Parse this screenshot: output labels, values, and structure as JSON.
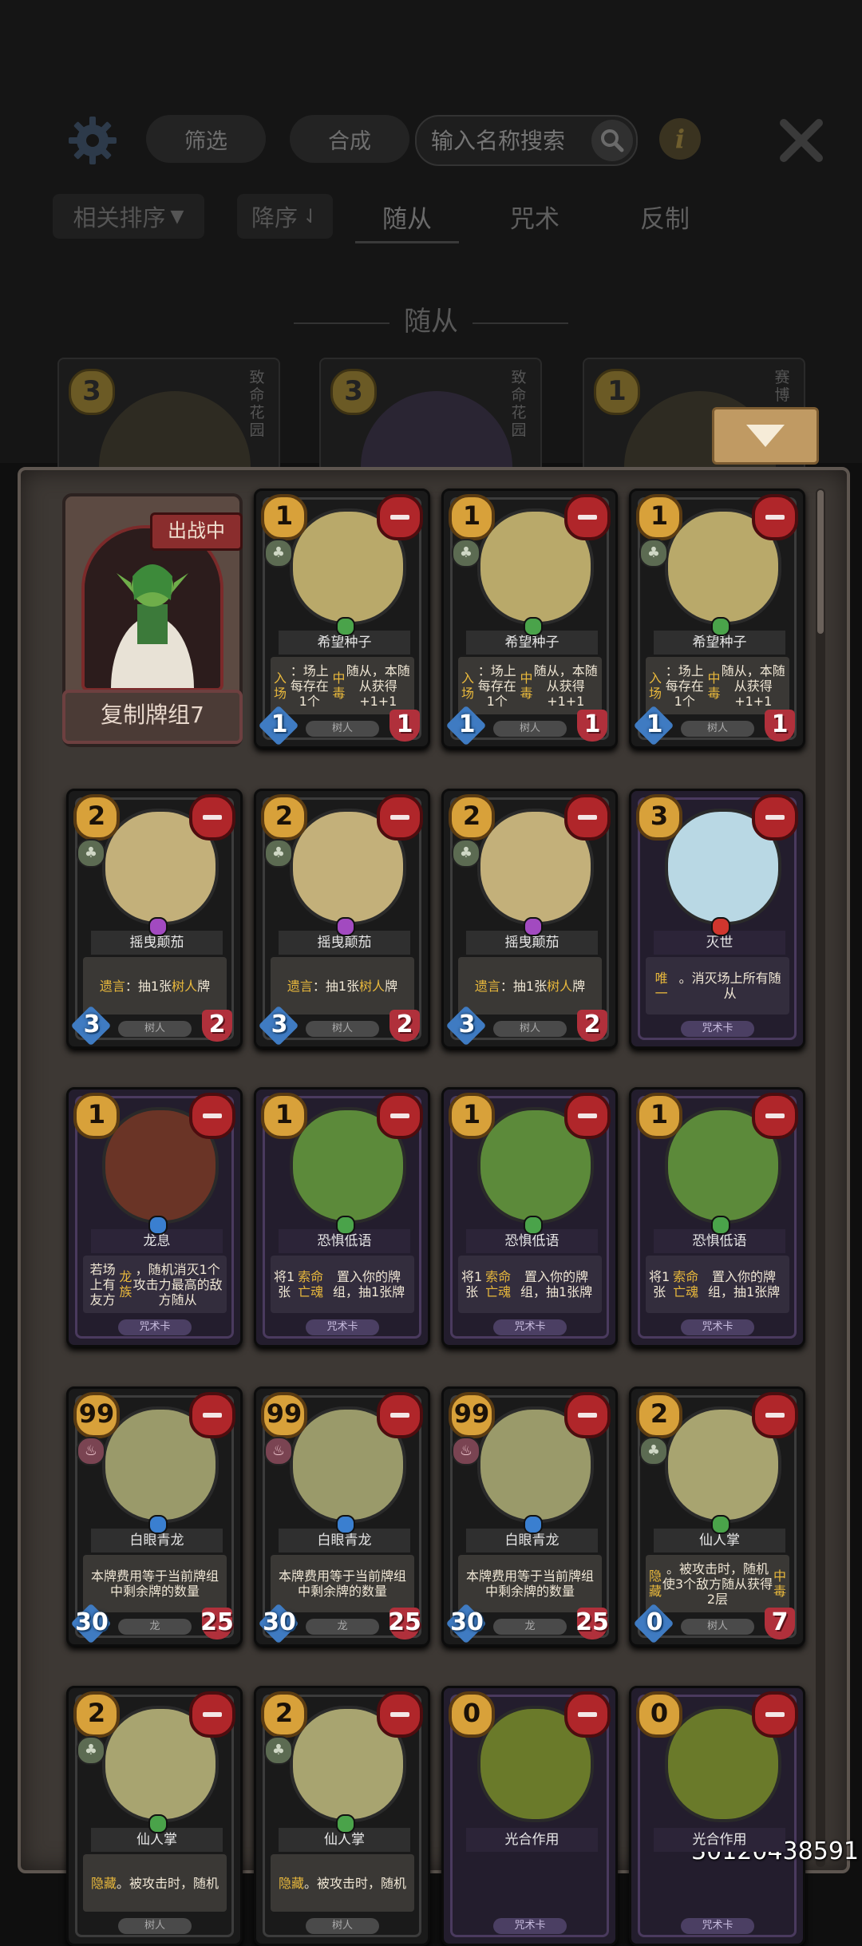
{
  "header": {
    "filter_label": "筛选",
    "synthesize_label": "合成",
    "search_placeholder": "输入名称搜索"
  },
  "tabs": {
    "sort_label": "相关排序",
    "order_label": "降序",
    "minion": "随从",
    "spell": "咒术",
    "counter": "反制"
  },
  "section_title": "随从",
  "top_cards": [
    {
      "cost": "3",
      "side": "致命花园"
    },
    {
      "cost": "3",
      "side": "致命花园"
    },
    {
      "cost": "1",
      "side": "赛博"
    }
  ],
  "deck": {
    "badge": "出战中",
    "name": "复制牌组7"
  },
  "cards": [
    {
      "cost": "1",
      "name": "希望种子",
      "type": "树人",
      "atk": "1",
      "hp": "1",
      "kind": "minion",
      "gem": "#4aa34a",
      "desc_html": "<span class='hl-y'>入场</span>：场上每存在1个<span class='hl-y'>中毒</span>随从，本随从获得+1+1"
    },
    {
      "cost": "1",
      "name": "希望种子",
      "type": "树人",
      "atk": "1",
      "hp": "1",
      "kind": "minion",
      "gem": "#4aa34a",
      "desc_html": "<span class='hl-y'>入场</span>：场上每存在1个<span class='hl-y'>中毒</span>随从，本随从获得+1+1"
    },
    {
      "cost": "1",
      "name": "希望种子",
      "type": "树人",
      "atk": "1",
      "hp": "1",
      "kind": "minion",
      "gem": "#4aa34a",
      "desc_html": "<span class='hl-y'>入场</span>：场上每存在1个<span class='hl-y'>中毒</span>随从，本随从获得+1+1"
    },
    {
      "cost": "2",
      "name": "摇曳颠茄",
      "type": "树人",
      "atk": "3",
      "hp": "2",
      "kind": "minion",
      "gem": "#a24ac0",
      "desc_html": "<span class='hl-y'>遗言</span>：抽1张<span class='hl-y'>树人</span>牌"
    },
    {
      "cost": "2",
      "name": "摇曳颠茄",
      "type": "树人",
      "atk": "3",
      "hp": "2",
      "kind": "minion",
      "gem": "#a24ac0",
      "desc_html": "<span class='hl-y'>遗言</span>：抽1张<span class='hl-y'>树人</span>牌"
    },
    {
      "cost": "2",
      "name": "摇曳颠茄",
      "type": "树人",
      "atk": "3",
      "hp": "2",
      "kind": "minion",
      "gem": "#a24ac0",
      "desc_html": "<span class='hl-y'>遗言</span>：抽1张<span class='hl-y'>树人</span>牌"
    },
    {
      "cost": "3",
      "name": "灭世",
      "type": "咒术卡",
      "kind": "spell",
      "gem": "#d0362e",
      "desc_html": "<span class='hl-y'>唯一</span>。消灭场上所有随从"
    },
    {
      "cost": "1",
      "name": "龙息",
      "type": "咒术卡",
      "kind": "spell",
      "gem": "#3a7fd0",
      "desc_html": "若场上有友方<span class='hl-y'>龙族</span>，随机消灭1个攻击力最高的敌方随从"
    },
    {
      "cost": "1",
      "name": "恐惧低语",
      "type": "咒术卡",
      "kind": "spell",
      "gem": "#4aa34a",
      "desc_html": "将1张<span class='hl-y'>索命亡魂</span>置入你的牌组，抽1张牌"
    },
    {
      "cost": "1",
      "name": "恐惧低语",
      "type": "咒术卡",
      "kind": "spell",
      "gem": "#4aa34a",
      "desc_html": "将1张<span class='hl-y'>索命亡魂</span>置入你的牌组，抽1张牌"
    },
    {
      "cost": "1",
      "name": "恐惧低语",
      "type": "咒术卡",
      "kind": "spell",
      "gem": "#4aa34a",
      "desc_html": "将1张<span class='hl-y'>索命亡魂</span>置入你的牌组，抽1张牌"
    },
    {
      "cost": "99",
      "name": "白眼青龙",
      "type": "龙",
      "atk": "30",
      "hp": "25",
      "kind": "minion",
      "dragon": true,
      "gem": "#3a7fd0",
      "desc_html": "本牌费用等于当前牌组中剩余牌的数量"
    },
    {
      "cost": "99",
      "name": "白眼青龙",
      "type": "龙",
      "atk": "30",
      "hp": "25",
      "kind": "minion",
      "dragon": true,
      "gem": "#3a7fd0",
      "desc_html": "本牌费用等于当前牌组中剩余牌的数量"
    },
    {
      "cost": "99",
      "name": "白眼青龙",
      "type": "龙",
      "atk": "30",
      "hp": "25",
      "kind": "minion",
      "dragon": true,
      "gem": "#3a7fd0",
      "desc_html": "本牌费用等于当前牌组中剩余牌的数量"
    },
    {
      "cost": "2",
      "name": "仙人掌",
      "type": "树人",
      "atk": "0",
      "hp": "7",
      "kind": "minion",
      "gem": "#4aa34a",
      "desc_html": "<span class='hl-y'>隐藏</span>。被攻击时，随机使3个敌方随从获得2层<span class='hl-y'>中毒</span>"
    },
    {
      "cost": "2",
      "name": "仙人掌",
      "type": "树人",
      "kind": "minion",
      "gem": "#4aa34a",
      "desc_html": "<span class='hl-y'>隐藏</span>。被攻击时，随机"
    },
    {
      "cost": "2",
      "name": "仙人掌",
      "type": "树人",
      "kind": "minion",
      "gem": "#4aa34a",
      "desc_html": "<span class='hl-y'>隐藏</span>。被攻击时，随机"
    },
    {
      "cost": "0",
      "name": "光合作用",
      "type": "咒术卡",
      "kind": "spell",
      "gem": "",
      "desc_html": ""
    },
    {
      "cost": "0",
      "name": "光合作用",
      "type": "咒术卡",
      "kind": "spell",
      "gem": "",
      "desc_html": ""
    }
  ],
  "watermark": "30120438591",
  "colors": {
    "accent_gold": "#d8a13a",
    "remove_red": "#b0262a",
    "atk_blue": "#3f7bc2",
    "hp_red": "#b0303b"
  }
}
